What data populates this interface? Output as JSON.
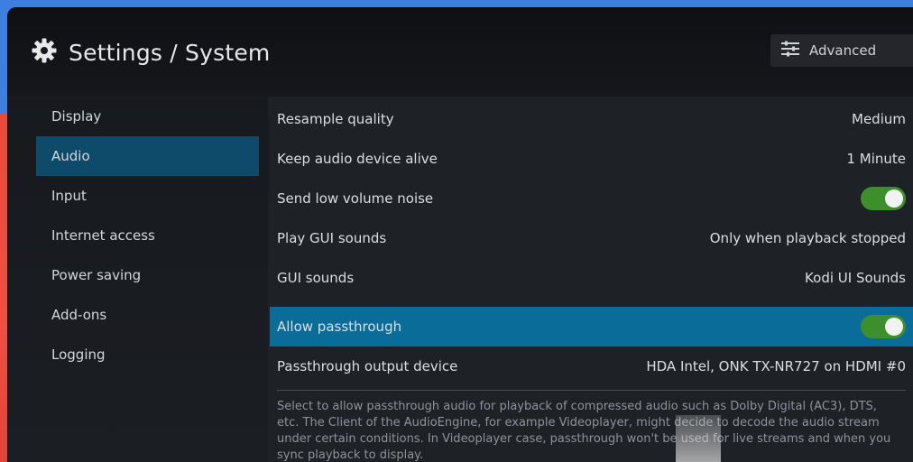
{
  "header": {
    "title": "Settings / System",
    "advanced_label": "Advanced"
  },
  "sidebar": {
    "items": [
      {
        "label": "Display"
      },
      {
        "label": "Audio"
      },
      {
        "label": "Input"
      },
      {
        "label": "Internet access"
      },
      {
        "label": "Power saving"
      },
      {
        "label": "Add-ons"
      },
      {
        "label": "Logging"
      }
    ]
  },
  "settings": [
    {
      "label": "Resample quality",
      "value": "Medium"
    },
    {
      "label": "Keep audio device alive",
      "value": "1 Minute"
    },
    {
      "label": "Send low volume noise",
      "toggle": true
    },
    {
      "label": "Play GUI sounds",
      "value": "Only when playback stopped"
    },
    {
      "label": "GUI sounds",
      "value": "Kodi UI Sounds"
    },
    {
      "label": "Allow passthrough",
      "toggle": true
    },
    {
      "label": "Passthrough output device",
      "value": "HDA Intel, ONK TX-NR727 on HDMI #0"
    }
  ],
  "description": "Select to allow passthrough audio for playback of compressed audio such as Dolby Digital (AC3), DTS, etc. The Client of the AudioEngine, for example Videoplayer, might decide to decode the audio stream under certain conditions. In Videoplayer case, passthrough won't be used for live streams and when you sync playback to display.",
  "colors": {
    "accent_active_row": "#0a6d99",
    "sidebar_active": "#0e4a6a",
    "toggle_on": "#3d8f2c"
  },
  "icons": {
    "title": "gear-icon",
    "advanced": "sliders-icon"
  }
}
